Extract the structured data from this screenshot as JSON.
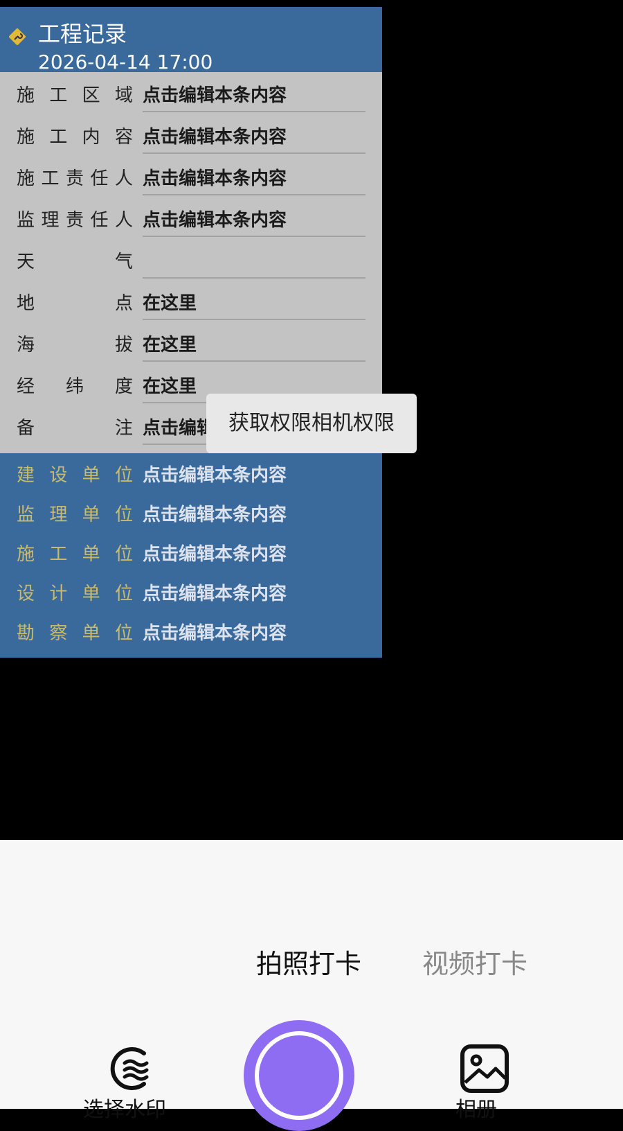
{
  "watermark": {
    "title": "工程记录",
    "datetime": "2026-04-14 17:00",
    "fields": [
      {
        "label": [
          "施",
          "工",
          "区",
          "域"
        ],
        "value": "点击编辑本条内容"
      },
      {
        "label": [
          "施",
          "工",
          "内",
          "容"
        ],
        "value": "点击编辑本条内容"
      },
      {
        "label": [
          "施",
          "工",
          "责",
          "任",
          "人"
        ],
        "value": "点击编辑本条内容"
      },
      {
        "label": [
          "监",
          "理",
          "责",
          "任",
          "人"
        ],
        "value": "点击编辑本条内容"
      },
      {
        "label": [
          "天",
          "气"
        ],
        "value": ""
      },
      {
        "label": [
          "地",
          "点"
        ],
        "value": "在这里"
      },
      {
        "label": [
          "海",
          "拔"
        ],
        "value": "在这里"
      },
      {
        "label": [
          "经",
          "纬",
          "度"
        ],
        "value": "在这里"
      },
      {
        "label": [
          "备",
          "注"
        ],
        "value": "点击编辑本条内容"
      }
    ],
    "units": [
      {
        "label": [
          "建",
          "设",
          "单",
          "位"
        ],
        "value": "点击编辑本条内容"
      },
      {
        "label": [
          "监",
          "理",
          "单",
          "位"
        ],
        "value": "点击编辑本条内容"
      },
      {
        "label": [
          "施",
          "工",
          "单",
          "位"
        ],
        "value": "点击编辑本条内容"
      },
      {
        "label": [
          "设",
          "计",
          "单",
          "位"
        ],
        "value": "点击编辑本条内容"
      },
      {
        "label": [
          "勘",
          "察",
          "单",
          "位"
        ],
        "value": "点击编辑本条内容"
      }
    ]
  },
  "toast": "获取权限相机权限",
  "modes": {
    "photo": "拍照打卡",
    "video": "视频打卡"
  },
  "bottom": {
    "left_label": "选择水印",
    "right_label": "相册",
    "left_icon": "watermark-wave-icon",
    "right_icon": "gallery-icon"
  },
  "colors": {
    "header_blue": "#3a6a9b",
    "panel_gray": "#c3c3c3",
    "unit_label_gold": "#c8bb6c",
    "shutter_purple": "#8f6df2"
  }
}
